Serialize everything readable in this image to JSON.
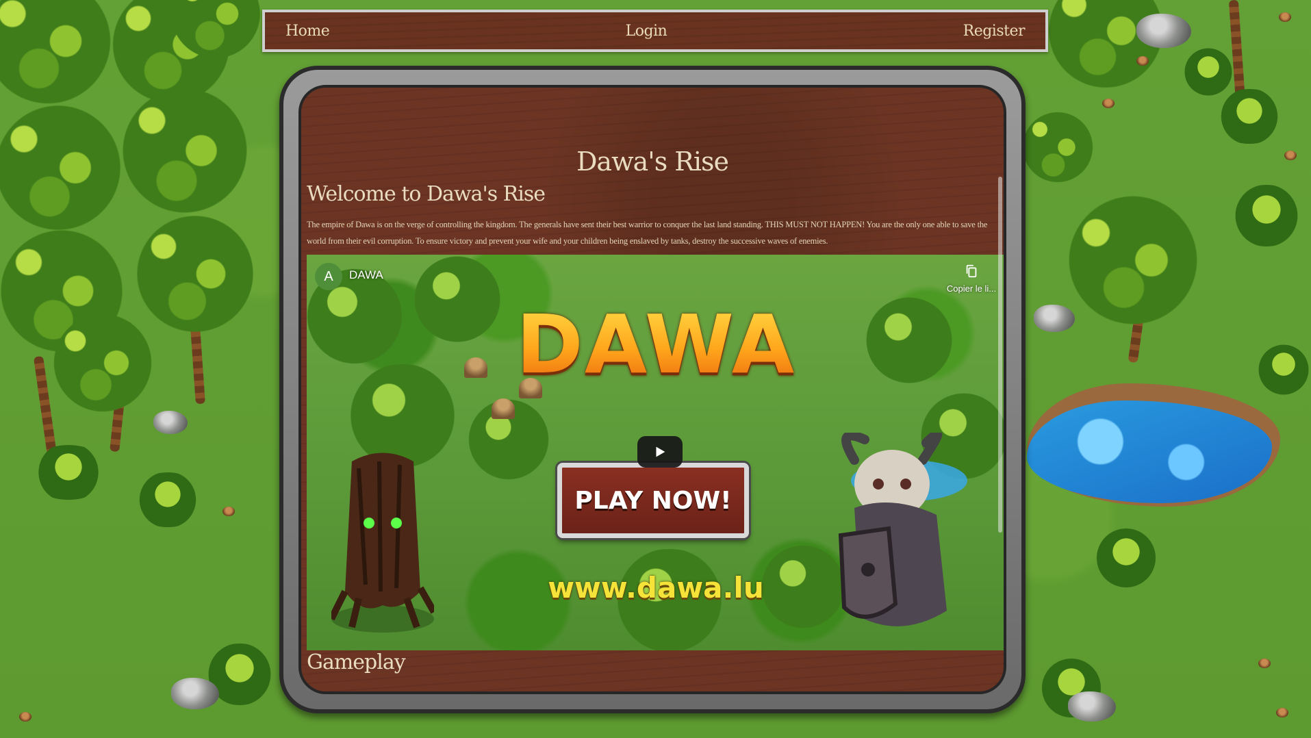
{
  "nav": {
    "home": "Home",
    "login": "Login",
    "register": "Register"
  },
  "page": {
    "title": "Dawa's Rise",
    "welcome_heading": "Welcome to Dawa's Rise",
    "intro": "The empire of Dawa is on the verge of controlling the kingdom. The generals have sent their best warrior to conquer the last land standing. THIS MUST NOT HAPPEN! You are the only one able to save the world from their evil corruption. To ensure victory and prevent your wife and your children being enslaved by tanks, destroy the successive waves of enemies.",
    "gameplay_heading": "Gameplay"
  },
  "video": {
    "channel_initial": "A",
    "channel_name": "DAWA",
    "copy_link_label": "Copier le li...",
    "logo_text": "DAWA",
    "play_now_text": "PLAY NOW!",
    "url_text": "www.dawa.lu"
  },
  "colors": {
    "wood": "#6b3423",
    "nav_text": "#eadbb8",
    "frame_border": "#cfcfcf",
    "grass": "#5f9a32"
  }
}
